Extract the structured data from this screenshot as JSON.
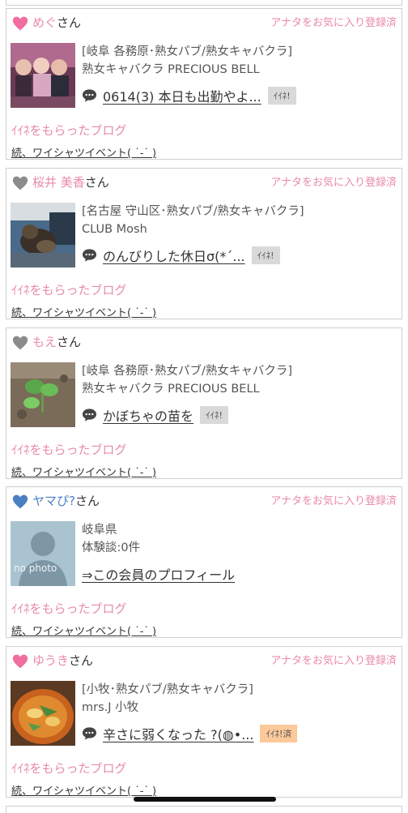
{
  "favorites": [
    {
      "name": "めぐ",
      "heart": "pink",
      "san": "さん",
      "fav_status": "アナタをお気に入り登録済",
      "info_line1": "[岐阜 各務原･熟女パブ/熟女キャバクラ]",
      "info_line2": "熟女キャバクラ PRECIOUS BELL",
      "blog_title": "0614(3) 本日も出勤やよ...",
      "iine_label": "ｲｲﾈ!",
      "liked_label": "ｲｲﾈをもらったブログ",
      "event_text": "続、ワイシャツイベント( ˙-˙ )"
    },
    {
      "name": "桜井 美香",
      "heart": "gray",
      "san": "さん",
      "fav_status": "アナタをお気に入り登録済",
      "info_line1": "[名古屋 守山区･熟女パブ/熟女キャバクラ]",
      "info_line2": "CLUB Mosh",
      "blog_title": "のんびりした休日σ(*´...",
      "iine_label": "ｲｲﾈ!",
      "liked_label": "ｲｲﾈをもらったブログ",
      "event_text": "続、ワイシャツイベント( ˙-˙ )"
    },
    {
      "name": "もえ",
      "heart": "gray",
      "san": "さん",
      "fav_status": "",
      "info_line1": "[岐阜 各務原･熟女パブ/熟女キャバクラ]",
      "info_line2": "熟女キャバクラ PRECIOUS BELL",
      "blog_title": "かぼちゃの苗を",
      "iine_label": "ｲｲﾈ!",
      "liked_label": "ｲｲﾈをもらったブログ",
      "event_text": "続、ワイシャツイベント( ˙-˙ )"
    },
    {
      "name": "ヤマぴ?",
      "heart": "blue",
      "san": "さん",
      "fav_status": "アナタをお気に入り登録済",
      "info_line1": "岐阜県",
      "info_line2": "体験談:0件",
      "profile_link": "⇒この会員のプロフィール",
      "no_photo": "no photo",
      "liked_label": "ｲｲﾈをもらったブログ",
      "event_text": "続、ワイシャツイベント( ˙-˙ )"
    },
    {
      "name": "ゆうき",
      "heart": "pink",
      "san": "さん",
      "fav_status": "アナタをお気に入り登録済",
      "info_line1": "[小牧･熟女パブ/熟女キャバクラ]",
      "info_line2": "mrs.J 小牧",
      "blog_title": "辛さに弱くなった ?(◍•...",
      "iine_label": "ｲｲﾈ!済",
      "liked_label": "ｲｲﾈをもらったブログ",
      "event_text": "続、ワイシャツイベント( ˙-˙ )"
    }
  ],
  "colors": {
    "pink": "#f06ea0",
    "gray": "#8c8c8c",
    "blue": "#4a7fc4",
    "accent_text": "#e88aa8",
    "iine_done_bg": "#fbc99a"
  }
}
